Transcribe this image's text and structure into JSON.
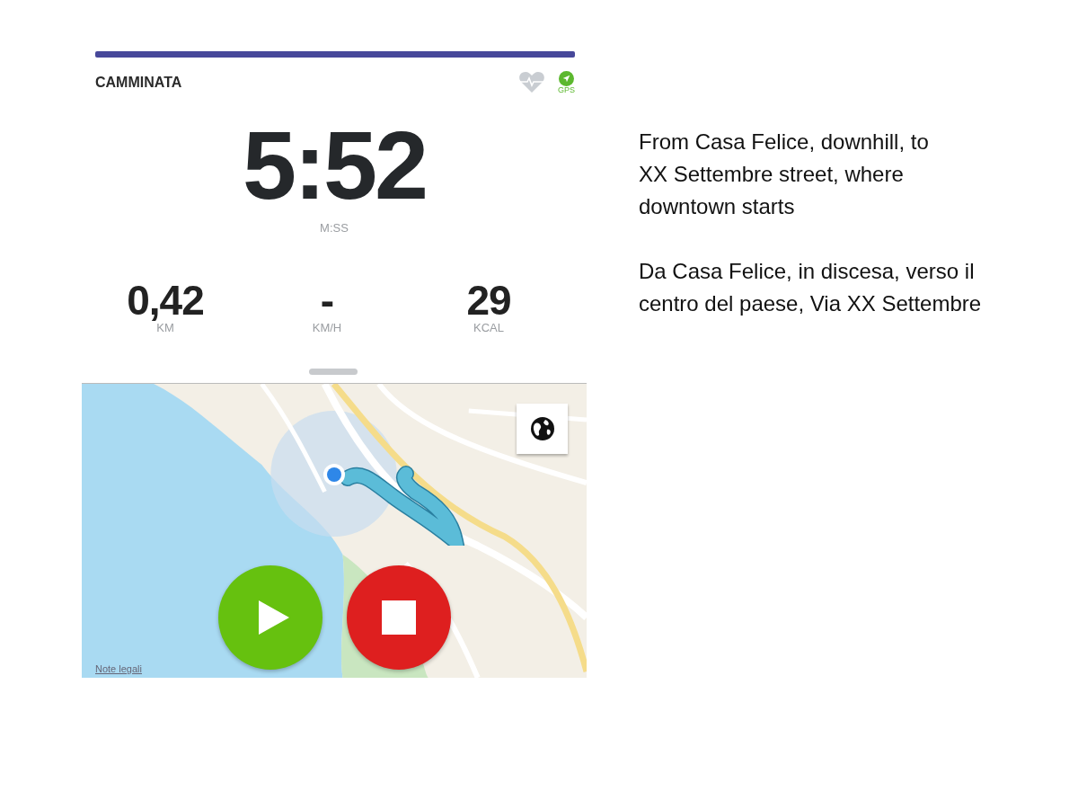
{
  "header": {
    "title": "CAMMINATA",
    "gps_label": "GPS"
  },
  "timer": {
    "value": "5:52",
    "unit": "M:SS"
  },
  "stats": [
    {
      "value": "0,42",
      "unit": "KM"
    },
    {
      "value": "-",
      "unit": "KM/H"
    },
    {
      "value": "29",
      "unit": "KCAL"
    }
  ],
  "map": {
    "kind": "picture",
    "legal_link": "Note legali"
  },
  "controls": [
    {
      "kind": "play"
    },
    {
      "kind": "stop"
    }
  ],
  "notes": [
    "From Casa Felice, downhill, to XX Settembre street, where downtown starts",
    "Da Casa Felice, in discesa, verso il centro del paese, Via XX Settembre"
  ]
}
